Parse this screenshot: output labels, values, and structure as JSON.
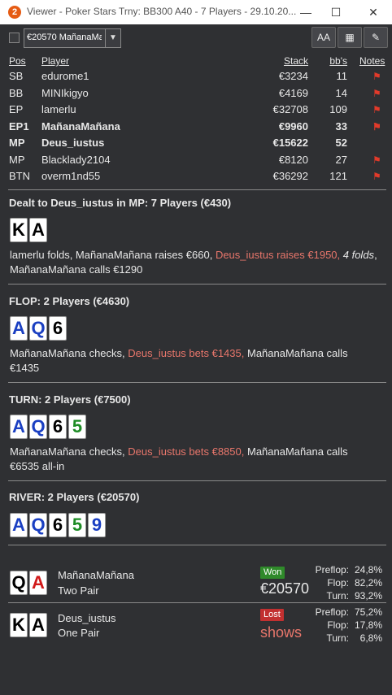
{
  "window": {
    "title": "Viewer - Poker Stars Trny: BB300 A40 - 7 Players - 29.10.20...",
    "icon": "pokerstars-icon",
    "minimize": "—",
    "maximize": "☐",
    "close": "✕"
  },
  "toolbar": {
    "hand_select": "€20570 MañanaMa",
    "font_button": "AA",
    "grid_button": "▦",
    "edit_button": "✎"
  },
  "table": {
    "headers": {
      "pos": "Pos",
      "player": "Player",
      "stack": "Stack",
      "bbs": "bb's",
      "notes": "Notes"
    },
    "rows": [
      {
        "pos": "SB",
        "player": "edurome1",
        "stack": "€3234",
        "bbs": "11",
        "note": true,
        "bold": false
      },
      {
        "pos": "BB",
        "player": "MINIkigyo",
        "stack": "€4169",
        "bbs": "14",
        "note": true,
        "bold": false
      },
      {
        "pos": "EP",
        "player": "lamerlu",
        "stack": "€32708",
        "bbs": "109",
        "note": true,
        "bold": false
      },
      {
        "pos": "EP1",
        "player": "MañanaMañana",
        "stack": "€9960",
        "bbs": "33",
        "note": true,
        "bold": true
      },
      {
        "pos": "MP",
        "player": "Deus_iustus",
        "stack": "€15622",
        "bbs": "52",
        "note": false,
        "bold": true
      },
      {
        "pos": "MP",
        "player": "Blacklady2104",
        "stack": "€8120",
        "bbs": "27",
        "note": true,
        "bold": false
      },
      {
        "pos": "BTN",
        "player": "overm1nd55",
        "stack": "€36292",
        "bbs": "121",
        "note": true,
        "bold": false
      }
    ]
  },
  "preflop": {
    "heading": "Dealt to Deus_iustus in MP: 7 Players (€430)",
    "cards": [
      {
        "rank": "K",
        "suit": "black"
      },
      {
        "rank": "A",
        "suit": "black"
      }
    ],
    "a1": "lamerlu folds, MañanaMañana raises €660, ",
    "a2": "Deus_iustus raises €1950,",
    "a3": " 4 folds",
    "a4": ", MañanaMañana calls €1290"
  },
  "flop": {
    "heading": "FLOP: 2 Players (€4630)",
    "cards": [
      {
        "rank": "A",
        "suit": "blue"
      },
      {
        "rank": "Q",
        "suit": "blue"
      },
      {
        "rank": "6",
        "suit": "black"
      }
    ],
    "a1": "MañanaMañana checks, ",
    "a2": "Deus_iustus bets €1435,",
    "a3": " MañanaMañana calls €1435"
  },
  "turn": {
    "heading": "TURN: 2 Players (€7500)",
    "cards": [
      {
        "rank": "A",
        "suit": "blue"
      },
      {
        "rank": "Q",
        "suit": "blue"
      },
      {
        "rank": "6",
        "suit": "black"
      },
      {
        "rank": "5",
        "suit": "green"
      }
    ],
    "a1": "MañanaMañana checks, ",
    "a2": "Deus_iustus bets €8850,",
    "a3": " MañanaMañana calls €6535 all-in"
  },
  "river": {
    "heading": "RIVER: 2 Players (€20570)",
    "cards": [
      {
        "rank": "A",
        "suit": "blue"
      },
      {
        "rank": "Q",
        "suit": "blue"
      },
      {
        "rank": "6",
        "suit": "black"
      },
      {
        "rank": "5",
        "suit": "green"
      },
      {
        "rank": "9",
        "suit": "blue"
      }
    ]
  },
  "results": [
    {
      "player": "MañanaMañana",
      "hand": "Two Pair",
      "cards": [
        {
          "rank": "Q",
          "suit": "black"
        },
        {
          "rank": "A",
          "suit": "red"
        }
      ],
      "badge": "Won",
      "badge_color": "#2f8a2a",
      "amount": "€20570",
      "amount_color": "#e8e8e8",
      "pre_label": "Preflop:",
      "pre": "24,8%",
      "flop_label": "Flop:",
      "flop": "82,2%",
      "turn_label": "Turn:",
      "turn": "93,2%"
    },
    {
      "player": "Deus_iustus",
      "hand": "One Pair",
      "cards": [
        {
          "rank": "K",
          "suit": "black"
        },
        {
          "rank": "A",
          "suit": "black"
        }
      ],
      "badge": "Lost",
      "badge_color": "#c23030",
      "amount": "shows",
      "amount_color": "#e8766b",
      "pre_label": "Preflop:",
      "pre": "75,2%",
      "flop_label": "Flop:",
      "flop": "17,8%",
      "turn_label": "Turn:",
      "turn": "6,8%"
    }
  ],
  "colors": {
    "highlight": "#e8766b",
    "flag": "#e23a2a",
    "background": "#2f3033"
  }
}
